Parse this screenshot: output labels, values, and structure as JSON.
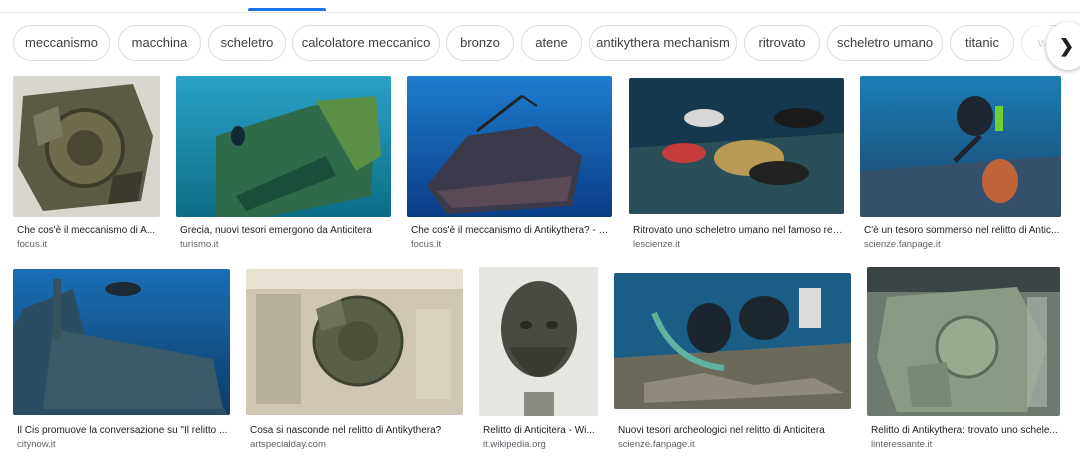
{
  "chips": [
    "meccanismo",
    "macchina",
    "scheletro",
    "calcolatore meccanico",
    "bronzo",
    "atene",
    "antikythera mechanism",
    "ritrovato",
    "scheletro umano",
    "titanic",
    "wi"
  ],
  "chips_next_icon": "chevron-right-icon",
  "results": [
    {
      "title": "Che cos'è il meccanismo di A...",
      "source": "focus.it"
    },
    {
      "title": "Grecia, nuovi tesori emergono da Anticitera",
      "source": "turismo.it"
    },
    {
      "title": "Che cos'è il meccanismo di Antikythera? - F...",
      "source": "focus.it"
    },
    {
      "title": "Ritrovato uno scheletro umano nel famoso rel...",
      "source": "lescienze.it"
    },
    {
      "title": "C'è un tesoro sommerso nel relitto di Antic...",
      "source": "scienze.fanpage.it"
    },
    {
      "title": "Il Cis promuove la conversazione su \"Il relitto ...",
      "source": "citynow.it"
    },
    {
      "title": "Cosa si nasconde nel relitto di Antikythera?",
      "source": "artspecialday.com"
    },
    {
      "title": "Relitto di Anticitera - Wi...",
      "source": "it.wikipedia.org"
    },
    {
      "title": "Nuovi tesori archeologici nel relitto di Anticitera",
      "source": "scienze.fanpage.it"
    },
    {
      "title": "Relitto di Antikythera: trovato uno schele...",
      "source": "linteressante.it"
    }
  ],
  "colors": {
    "accent": "#1a73e8",
    "chip_border": "#dadce0"
  }
}
